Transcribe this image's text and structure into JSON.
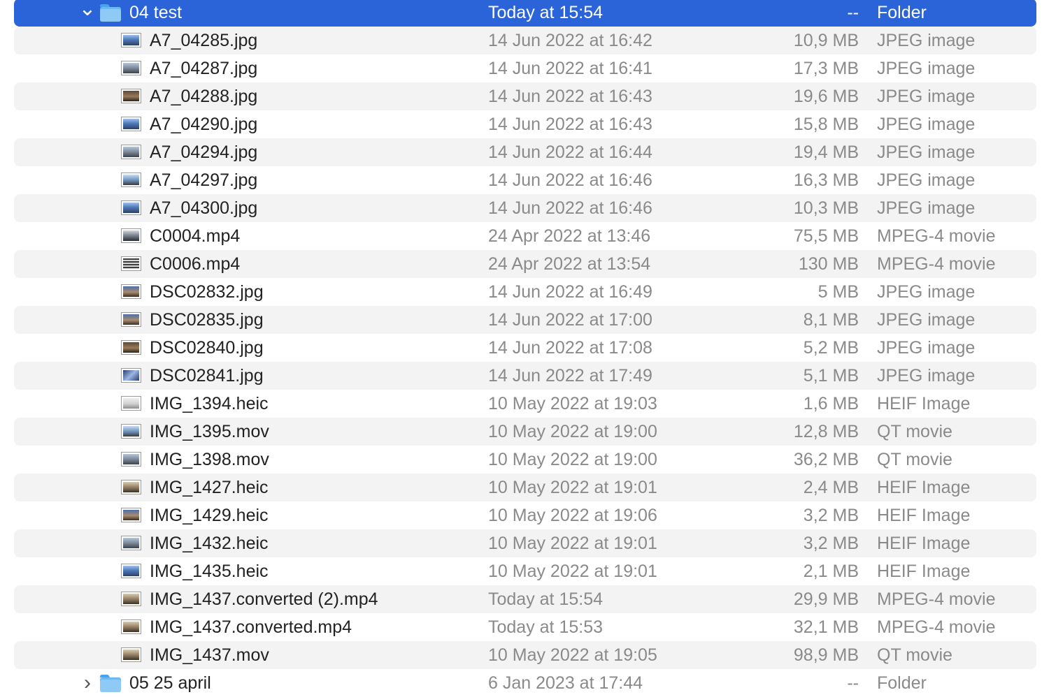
{
  "folders": {
    "expanded": {
      "name": "04 test",
      "date": "Today at 15:54",
      "size": "--",
      "kind": "Folder",
      "icon": "folder-icon",
      "chevron": "chevron-down-icon",
      "selected": true
    },
    "collapsed": {
      "name": "05 25 april",
      "date": "6 Jan 2023 at 17:44",
      "size": "--",
      "kind": "Folder",
      "icon": "folder-icon",
      "chevron": "chevron-right-icon",
      "selected": false
    }
  },
  "files": [
    {
      "name": "A7_04285.jpg",
      "date": "14 Jun 2022 at 16:42",
      "size": "10,9 MB",
      "kind": "JPEG image",
      "icon": "photo-thumbnail-icon",
      "thumb": "t-blue"
    },
    {
      "name": "A7_04287.jpg",
      "date": "14 Jun 2022 at 16:41",
      "size": "17,3 MB",
      "kind": "JPEG image",
      "icon": "photo-thumbnail-icon",
      "thumb": "t-city"
    },
    {
      "name": "A7_04288.jpg",
      "date": "14 Jun 2022 at 16:43",
      "size": "19,6 MB",
      "kind": "JPEG image",
      "icon": "photo-thumbnail-icon",
      "thumb": "t-dark"
    },
    {
      "name": "A7_04290.jpg",
      "date": "14 Jun 2022 at 16:43",
      "size": "15,8 MB",
      "kind": "JPEG image",
      "icon": "photo-thumbnail-icon",
      "thumb": "t-blue"
    },
    {
      "name": "A7_04294.jpg",
      "date": "14 Jun 2022 at 16:44",
      "size": "19,4 MB",
      "kind": "JPEG image",
      "icon": "photo-thumbnail-icon",
      "thumb": "t-city"
    },
    {
      "name": "A7_04297.jpg",
      "date": "14 Jun 2022 at 16:46",
      "size": "16,3 MB",
      "kind": "JPEG image",
      "icon": "photo-thumbnail-icon",
      "thumb": "t-sky"
    },
    {
      "name": "A7_04300.jpg",
      "date": "14 Jun 2022 at 16:46",
      "size": "10,3 MB",
      "kind": "JPEG image",
      "icon": "photo-thumbnail-icon",
      "thumb": "t-blue"
    },
    {
      "name": "C0004.mp4",
      "date": "24 Apr 2022 at 13:46",
      "size": "75,5 MB",
      "kind": "MPEG-4 movie",
      "icon": "video-thumbnail-icon",
      "thumb": "t-film"
    },
    {
      "name": "C0006.mp4",
      "date": "24 Apr 2022 at 13:54",
      "size": "130 MB",
      "kind": "MPEG-4 movie",
      "icon": "video-thumbnail-icon",
      "thumb": "t-stripes"
    },
    {
      "name": "DSC02832.jpg",
      "date": "14 Jun 2022 at 16:49",
      "size": "5 MB",
      "kind": "JPEG image",
      "icon": "photo-thumbnail-icon",
      "thumb": "t-dusk"
    },
    {
      "name": "DSC02835.jpg",
      "date": "14 Jun 2022 at 17:00",
      "size": "8,1 MB",
      "kind": "JPEG image",
      "icon": "photo-thumbnail-icon",
      "thumb": "t-dusk"
    },
    {
      "name": "DSC02840.jpg",
      "date": "14 Jun 2022 at 17:08",
      "size": "5,2 MB",
      "kind": "JPEG image",
      "icon": "photo-thumbnail-icon",
      "thumb": "t-dark"
    },
    {
      "name": "DSC02841.jpg",
      "date": "14 Jun 2022 at 17:49",
      "size": "5,1 MB",
      "kind": "JPEG image",
      "icon": "photo-thumbnail-icon",
      "thumb": "t-cross"
    },
    {
      "name": "IMG_1394.heic",
      "date": "10 May 2022 at 19:03",
      "size": "1,6 MB",
      "kind": "HEIF Image",
      "icon": "photo-thumbnail-icon",
      "thumb": "t-light"
    },
    {
      "name": "IMG_1395.mov",
      "date": "10 May 2022 at 19:00",
      "size": "12,8 MB",
      "kind": "QT movie",
      "icon": "video-thumbnail-icon",
      "thumb": "t-sky"
    },
    {
      "name": "IMG_1398.mov",
      "date": "10 May 2022 at 19:00",
      "size": "36,2 MB",
      "kind": "QT movie",
      "icon": "video-thumbnail-icon",
      "thumb": "t-city"
    },
    {
      "name": "IMG_1427.heic",
      "date": "10 May 2022 at 19:01",
      "size": "2,4 MB",
      "kind": "HEIF Image",
      "icon": "photo-thumbnail-icon",
      "thumb": "t-sepia"
    },
    {
      "name": "IMG_1429.heic",
      "date": "10 May 2022 at 19:06",
      "size": "3,2 MB",
      "kind": "HEIF Image",
      "icon": "photo-thumbnail-icon",
      "thumb": "t-dusk"
    },
    {
      "name": "IMG_1432.heic",
      "date": "10 May 2022 at 19:01",
      "size": "3,2 MB",
      "kind": "HEIF Image",
      "icon": "photo-thumbnail-icon",
      "thumb": "t-city"
    },
    {
      "name": "IMG_1435.heic",
      "date": "10 May 2022 at 19:01",
      "size": "2,1 MB",
      "kind": "HEIF Image",
      "icon": "photo-thumbnail-icon",
      "thumb": "t-blue"
    },
    {
      "name": "IMG_1437.converted (2).mp4",
      "date": "Today at 15:54",
      "size": "29,9 MB",
      "kind": "MPEG-4 movie",
      "icon": "video-thumbnail-icon",
      "thumb": "t-sepia"
    },
    {
      "name": "IMG_1437.converted.mp4",
      "date": "Today at 15:53",
      "size": "32,1 MB",
      "kind": "MPEG-4 movie",
      "icon": "video-thumbnail-icon",
      "thumb": "t-sepia"
    },
    {
      "name": "IMG_1437.mov",
      "date": "10 May 2022 at 19:05",
      "size": "98,9 MB",
      "kind": "QT movie",
      "icon": "video-thumbnail-icon",
      "thumb": "t-sepia"
    }
  ],
  "colors": {
    "selection": "#2b64d8",
    "stripe": "#f3f3f3",
    "name_text": "#222222",
    "secondary_text": "#8a8a8a",
    "folder_blue": "#6cb8f2"
  }
}
